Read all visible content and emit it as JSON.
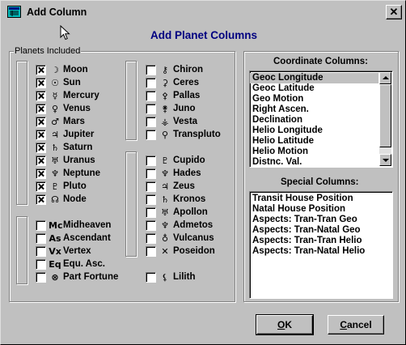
{
  "window": {
    "title": "Add Column",
    "close_label": "✕"
  },
  "heading": "Add Planet Columns",
  "planets_group": {
    "label": "Planets Included",
    "col1": [
      {
        "glyph": "☽",
        "label": "Moon",
        "checked": true
      },
      {
        "glyph": "☉",
        "label": "Sun",
        "checked": true
      },
      {
        "glyph": "☿",
        "label": "Mercury",
        "checked": true
      },
      {
        "glyph": "♀",
        "label": "Venus",
        "checked": true
      },
      {
        "glyph": "♂",
        "label": "Mars",
        "checked": true
      },
      {
        "glyph": "♃",
        "label": "Jupiter",
        "checked": true
      },
      {
        "glyph": "♄",
        "label": "Saturn",
        "checked": true
      },
      {
        "glyph": "♅",
        "label": "Uranus",
        "checked": true
      },
      {
        "glyph": "♆",
        "label": "Neptune",
        "checked": true
      },
      {
        "glyph": "♇",
        "label": "Pluto",
        "checked": true
      },
      {
        "glyph": "☊",
        "label": "Node",
        "checked": true
      },
      {
        "glyph": "Mc",
        "label": "Midheaven",
        "checked": false
      },
      {
        "glyph": "As",
        "label": "Ascendant",
        "checked": false
      },
      {
        "glyph": "Vx",
        "label": "Vertex",
        "checked": false
      },
      {
        "glyph": "Eq",
        "label": "Equ. Asc.",
        "checked": false
      },
      {
        "glyph": "⊗",
        "label": "Part Fortune",
        "checked": false
      }
    ],
    "col2": [
      {
        "glyph": "⚷",
        "label": "Chiron",
        "checked": false
      },
      {
        "glyph": "⚳",
        "label": "Ceres",
        "checked": false
      },
      {
        "glyph": "⚴",
        "label": "Pallas",
        "checked": false
      },
      {
        "glyph": "⚵",
        "label": "Juno",
        "checked": false
      },
      {
        "glyph": "⚶",
        "label": "Vesta",
        "checked": false
      },
      {
        "glyph": "⚲",
        "label": "Transpluto",
        "checked": false
      },
      {
        "glyph": "♇",
        "label": "Cupido",
        "checked": false
      },
      {
        "glyph": "♆",
        "label": "Hades",
        "checked": false
      },
      {
        "glyph": "♃",
        "label": "Zeus",
        "checked": false
      },
      {
        "glyph": "♄",
        "label": "Kronos",
        "checked": false
      },
      {
        "glyph": "♅",
        "label": "Apollon",
        "checked": false
      },
      {
        "glyph": "♆",
        "label": "Admetos",
        "checked": false
      },
      {
        "glyph": "♁",
        "label": "Vulcanus",
        "checked": false
      },
      {
        "glyph": "✕",
        "label": "Poseidon",
        "checked": false
      },
      {
        "glyph": "⚸",
        "label": "Lilith",
        "checked": false
      }
    ]
  },
  "coordinate_columns": {
    "label": "Coordinate Columns:",
    "items": [
      "Geoc Longitude",
      "Geoc Latitude",
      "Geo Motion",
      "Right Ascen.",
      "Declination",
      "Helio Longitude",
      "Helio Latitude",
      "Helio Motion",
      "Distnc. Val."
    ],
    "selected_index": 0
  },
  "special_columns": {
    "label": "Special Columns:",
    "items": [
      "Transit House Position",
      "Natal House Position",
      "Aspects: Tran-Tran  Geo",
      "Aspects: Tran-Natal Geo",
      "Aspects: Tran-Tran  Helio",
      "Aspects: Tran-Natal Helio"
    ]
  },
  "buttons": {
    "ok_u": "O",
    "ok_rest": "K",
    "cancel_u": "C",
    "cancel_rest": "ancel"
  }
}
